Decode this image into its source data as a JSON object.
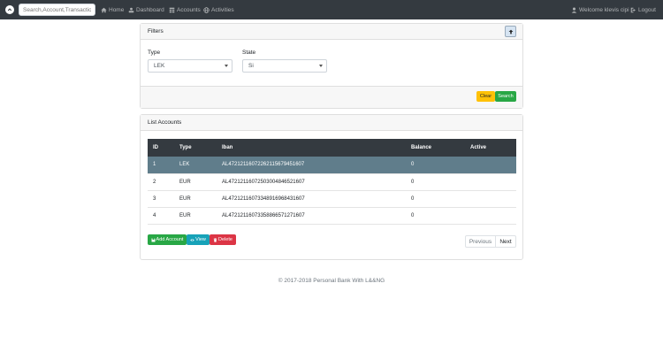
{
  "navbar": {
    "search_placeholder": "Search,Account,Transactio",
    "links": {
      "home": "Home",
      "dashboard": "Dashboard",
      "accounts": "Accounts",
      "activities": "Activities"
    },
    "welcome": "Welcome klevis cipi",
    "logout": "Logout"
  },
  "filters": {
    "title": "Filters",
    "type_label": "Type",
    "type_value": "LEK",
    "state_label": "State",
    "state_value": "Si",
    "clear_label": "Clear",
    "search_label": "Search"
  },
  "accounts": {
    "title": "List Accounts",
    "columns": [
      "ID",
      "Type",
      "Iban",
      "Balance",
      "Active"
    ],
    "rows": [
      {
        "id": "1",
        "type": "LEK",
        "iban": "AL47212116072262115679451607",
        "balance": "0",
        "active": ""
      },
      {
        "id": "2",
        "type": "EUR",
        "iban": "AL47212116072503004846521607",
        "balance": "0",
        "active": ""
      },
      {
        "id": "3",
        "type": "EUR",
        "iban": "AL47212116073348916968431607",
        "balance": "0",
        "active": ""
      },
      {
        "id": "4",
        "type": "EUR",
        "iban": "AL47212116073358866571271607",
        "balance": "0",
        "active": ""
      }
    ],
    "add_label": "Add Account",
    "view_label": "View",
    "delete_label": "Delete",
    "previous_label": "Previous",
    "next_label": "Next"
  },
  "footer": {
    "copyright": "© 2017-2018 Personal Bank With L&&NG"
  },
  "colors": {
    "navbar": "#343a40",
    "selected_row": "#607d8b",
    "clear": "#ffc107",
    "search": "#28a745",
    "add": "#28a745",
    "view": "#17a2b8",
    "delete": "#dc3545"
  }
}
